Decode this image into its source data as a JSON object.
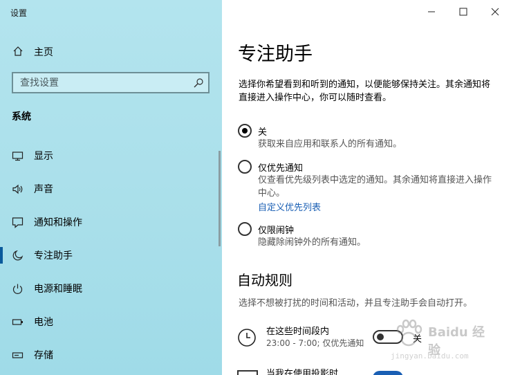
{
  "window": {
    "title": "设置"
  },
  "sidebar": {
    "home_label": "主页",
    "search_placeholder": "查找设置",
    "section_title": "系统",
    "items": [
      {
        "label": "显示",
        "icon": "monitor-icon"
      },
      {
        "label": "声音",
        "icon": "speaker-icon"
      },
      {
        "label": "通知和操作",
        "icon": "notification-icon"
      },
      {
        "label": "专注助手",
        "icon": "moon-icon",
        "active": true
      },
      {
        "label": "电源和睡眠",
        "icon": "power-icon"
      },
      {
        "label": "电池",
        "icon": "battery-icon"
      },
      {
        "label": "存储",
        "icon": "storage-icon"
      }
    ]
  },
  "main": {
    "title": "专注助手",
    "description": "选择你希望看到和听到的通知，以便能够保持关注。其余通知将直接进入操作中心，你可以随时查看。",
    "options": [
      {
        "label": "关",
        "desc": "获取来自应用和联系人的所有通知。",
        "checked": true
      },
      {
        "label": "仅优先通知",
        "desc": "仅查看优先级列表中选定的通知。其余通知将直接进入操作中心。",
        "link": "自定义优先列表",
        "checked": false
      },
      {
        "label": "仅限闹钟",
        "desc": "隐藏除闹钟外的所有通知。",
        "checked": false
      }
    ],
    "auto_rules": {
      "title": "自动规则",
      "desc": "选择不想被打扰的时间和活动，并且专注助手会自动打开。",
      "rules": [
        {
          "title": "在这些时间段内",
          "sub": "23:00 - 7:00; 仅优先通知",
          "toggle_label": "关",
          "on": false
        },
        {
          "title": "当我在使用投影时",
          "on": true
        }
      ]
    }
  },
  "watermark": {
    "logo": "Baidu 经验",
    "url": "jingyan.baidu.com"
  },
  "colors": {
    "accent": "#1a5fb4",
    "sidebar_bg": "#aee1ec",
    "active_bar": "#0a5a9c"
  }
}
